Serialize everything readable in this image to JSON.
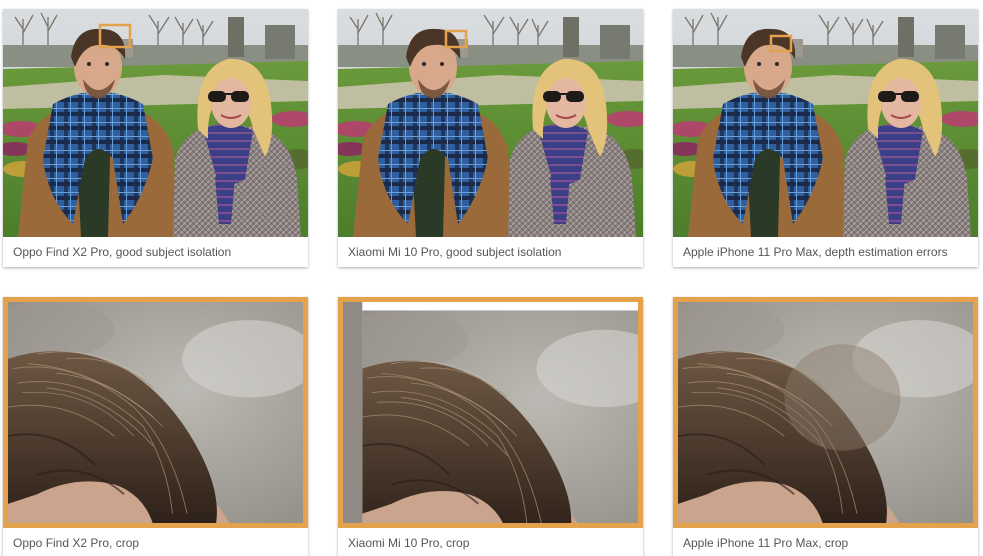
{
  "accent_color": "#e4a24d",
  "caption_color": "#555555",
  "cards": [
    {
      "caption": "Oppo Find X2 Pro, good subject isolation",
      "kind": "portrait"
    },
    {
      "caption": "Xiaomi Mi 10 Pro, good subject isolation",
      "kind": "portrait"
    },
    {
      "caption": "Apple iPhone 11 Pro Max, depth estimation errors",
      "kind": "portrait"
    },
    {
      "caption": "Oppo Find X2 Pro, crop",
      "kind": "crop"
    },
    {
      "caption": "Xiaomi Mi 10 Pro, crop",
      "kind": "crop"
    },
    {
      "caption": "Apple iPhone 11 Pro Max, crop",
      "kind": "crop"
    }
  ]
}
